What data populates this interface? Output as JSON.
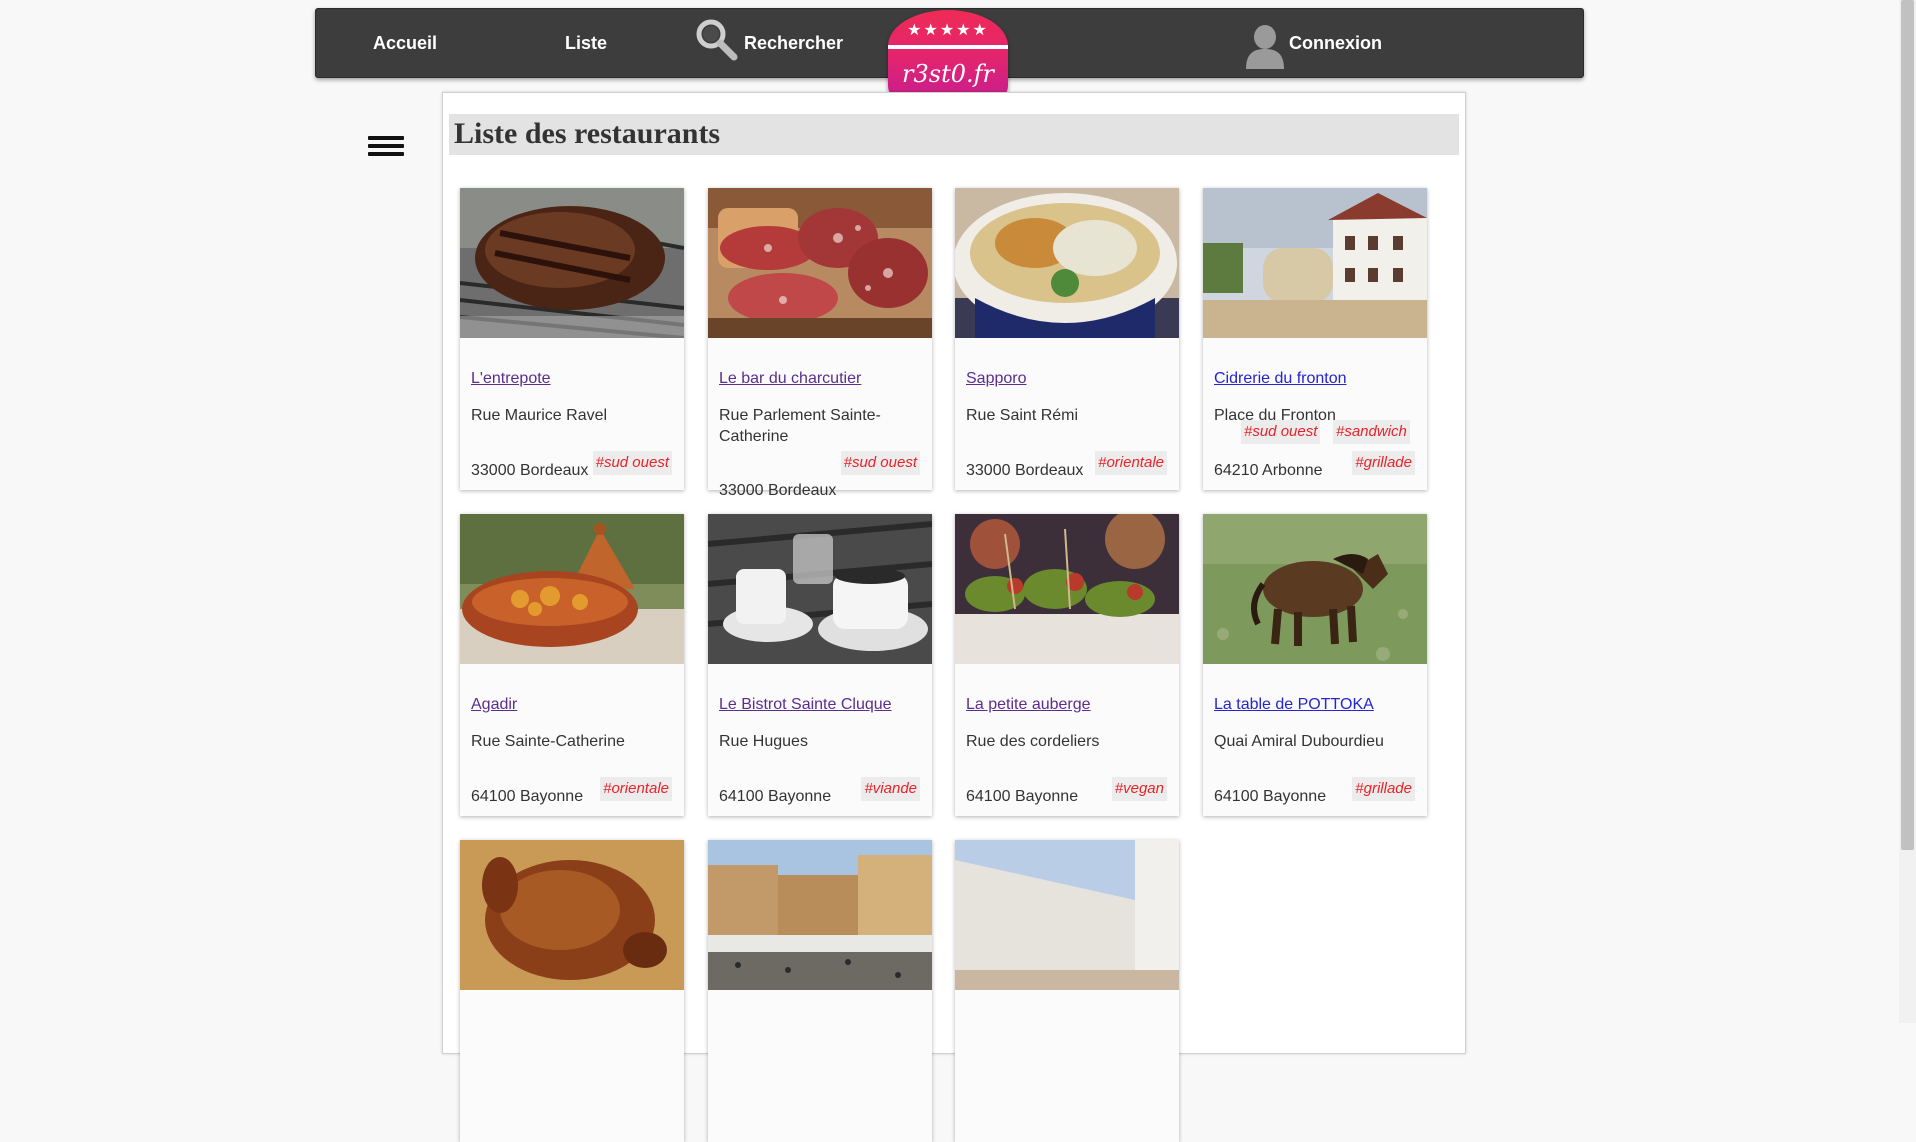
{
  "nav": {
    "accueil": "Accueil",
    "liste": "Liste",
    "rechercher": "Rechercher",
    "connexion": "Connexion"
  },
  "logo": {
    "stars": "★★★★★",
    "text": "r3st0.fr"
  },
  "page": {
    "title": "Liste des restaurants"
  },
  "restaurants": [
    {
      "name": "L'entrepote",
      "street": "Rue Maurice Ravel",
      "city": "33000 Bordeaux",
      "tags": [
        "#sud ouest"
      ]
    },
    {
      "name": "Le bar du charcutier",
      "street": "Rue Parlement Sainte-Catherine",
      "city": "33000 Bordeaux",
      "tags": [
        "#sud ouest"
      ]
    },
    {
      "name": "Sapporo",
      "street": "Rue Saint Rémi",
      "city": "33000 Bordeaux",
      "tags": [
        "#orientale"
      ]
    },
    {
      "name": "Cidrerie du fronton",
      "street": "Place du Fronton",
      "city": "64210 Arbonne",
      "tags": [
        "#sud ouest",
        "#sandwich",
        "#grillade"
      ]
    },
    {
      "name": "Agadir",
      "street": "Rue Sainte-Catherine",
      "city": "64100 Bayonne",
      "tags": [
        "#orientale"
      ]
    },
    {
      "name": "Le Bistrot Sainte Cluque",
      "street": "Rue Hugues",
      "city": "64100 Bayonne",
      "tags": [
        "#viande"
      ]
    },
    {
      "name": "La petite auberge",
      "street": "Rue des cordeliers",
      "city": "64100 Bayonne",
      "tags": [
        "#vegan"
      ]
    },
    {
      "name": "La table de POTTOKA",
      "street": "Quai Amiral Dubourdieu",
      "city": "64100 Bayonne",
      "tags": [
        "#grillade"
      ]
    }
  ],
  "colors": {
    "nav_bg": "#3d3d3d",
    "logo_pink": "#e22470",
    "tag_text": "#e8232a",
    "link_visited": "#5b2d8e",
    "link": "#2424d0"
  }
}
